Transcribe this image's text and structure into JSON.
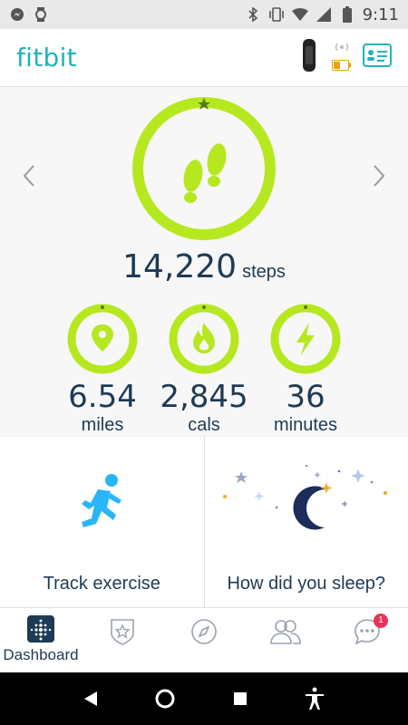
{
  "status": {
    "time": "9:11",
    "icons": [
      "messenger-icon",
      "watch-icon",
      "bluetooth-icon",
      "vibrate-icon",
      "wifi-icon",
      "signal-icon",
      "battery-icon"
    ]
  },
  "header": {
    "brand": "fitbit",
    "icons": [
      "tracker-icon",
      "sync-icon",
      "low-battery-icon",
      "account-card-icon"
    ]
  },
  "colors": {
    "accent": "#b6e820",
    "brand": "#20b4b9",
    "text": "#1e3a55"
  },
  "steps": {
    "value": "14,220",
    "unit": "steps",
    "goal_progress": 1.0
  },
  "metrics": [
    {
      "value": "6.54",
      "unit": "miles",
      "icon": "location-pin-icon"
    },
    {
      "value": "2,845",
      "unit": "cals",
      "icon": "flame-icon"
    },
    {
      "value": "36",
      "unit": "minutes",
      "icon": "lightning-icon"
    }
  ],
  "tiles": [
    {
      "label": "Track exercise",
      "icon": "running-figure-icon"
    },
    {
      "label": "How did you sleep?",
      "icon": "moon-stars-icon"
    }
  ],
  "nav": {
    "items": [
      {
        "label": "Dashboard",
        "icon": "dashboard-icon",
        "active": true
      },
      {
        "label": "",
        "icon": "challenges-icon"
      },
      {
        "label": "",
        "icon": "discover-icon"
      },
      {
        "label": "",
        "icon": "community-icon"
      },
      {
        "label": "",
        "icon": "messages-icon",
        "badge": "1"
      }
    ]
  }
}
